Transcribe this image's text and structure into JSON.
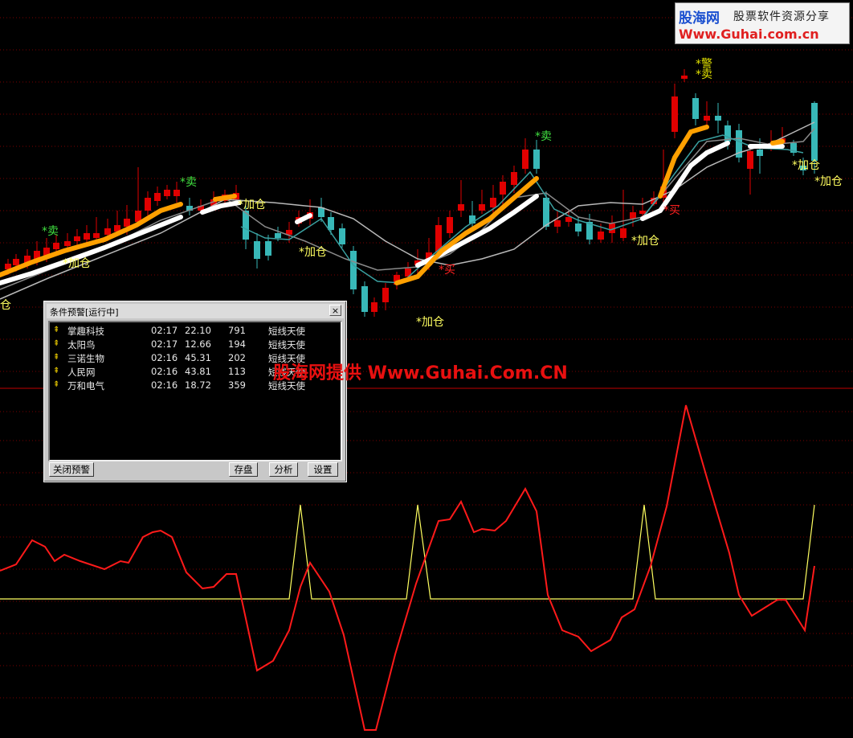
{
  "logo": {
    "site": "股海网",
    "tagline": "股票软件资源分享",
    "url": "Www.Guhai.com.cn"
  },
  "watermark": "股海网提供 Www.Guhai.Com.CN",
  "chart_labels": {
    "sell": [
      "*卖",
      "*卖",
      "*卖",
      "*警"
    ],
    "buy": [
      "*买",
      "*买"
    ],
    "add": [
      "*加仓",
      "*加仓",
      "*加仓",
      "*加仓",
      "*加仓",
      "*加仓",
      "*加仓",
      "*加仓",
      "仓"
    ],
    "sell_top": "*卖"
  },
  "alert_window": {
    "title": "条件预警[运行中]",
    "close_label": "×",
    "rows": [
      {
        "name": "掌趣科技",
        "time": "02:17",
        "price": "22.10",
        "volume": "791",
        "signal": "短线天使"
      },
      {
        "name": "太阳鸟",
        "time": "02:17",
        "price": "12.66",
        "volume": "194",
        "signal": "短线天使"
      },
      {
        "name": "三诺生物",
        "time": "02:16",
        "price": "45.31",
        "volume": "202",
        "signal": "短线天使"
      },
      {
        "name": "人民网",
        "time": "02:16",
        "price": "43.81",
        "volume": "113",
        "signal": "短线天使"
      },
      {
        "name": "万和电气",
        "time": "02:16",
        "price": "18.72",
        "volume": "359",
        "signal": "短线天使"
      }
    ],
    "buttons": {
      "close_alert": "关闭预警",
      "save": "存盘",
      "analyze": "分析",
      "settings": "设置"
    }
  },
  "colors": {
    "up": "#e00000",
    "down": "#38b8b8",
    "orange": "#ffa000",
    "white": "#ffffff",
    "signal_red": "#ff2020",
    "signal_yellow": "#ffff60"
  }
}
